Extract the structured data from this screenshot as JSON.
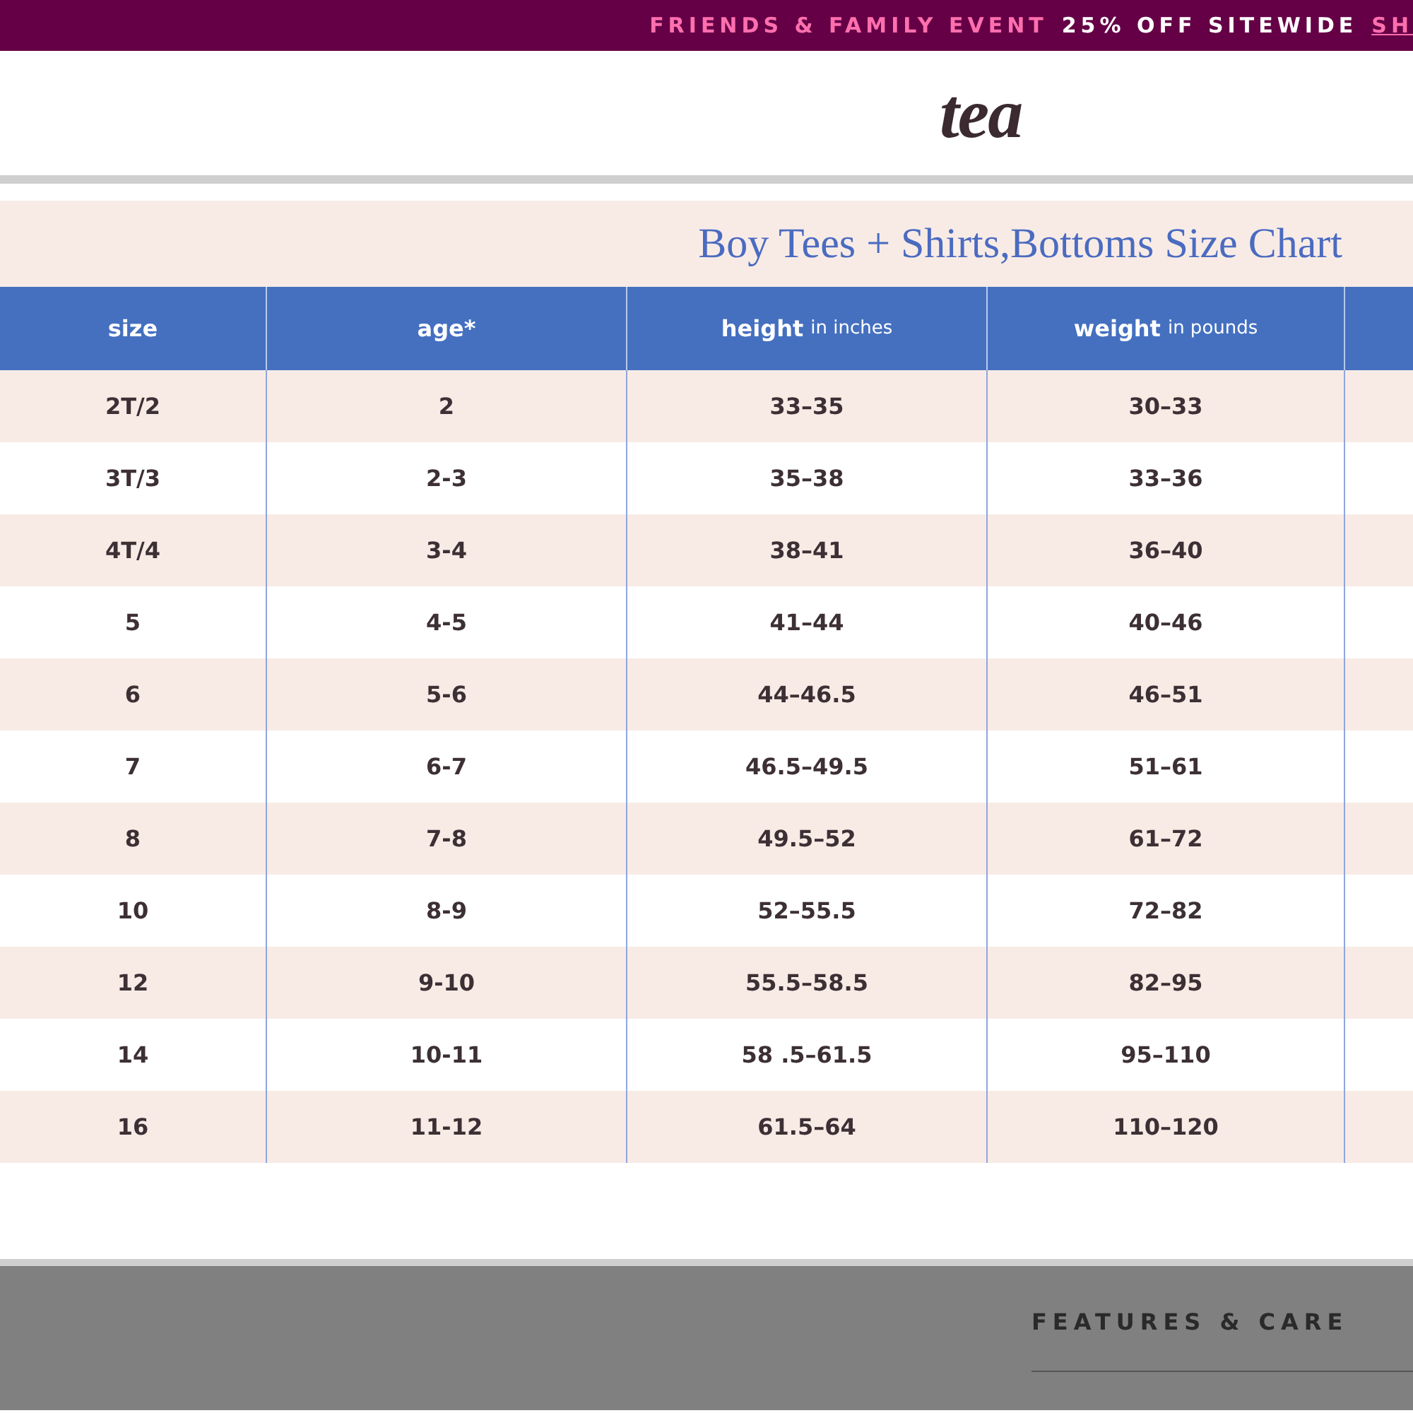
{
  "promo_banner": {
    "event": "FRIENDS & FAMILY EVENT",
    "offer": "25% OFF SITEWIDE",
    "link": "SH"
  },
  "header": {
    "logo": "tea"
  },
  "size_chart": {
    "title": "Boy Tees + Shirts,Bottoms Size Chart",
    "columns": [
      {
        "label": "size"
      },
      {
        "label": "age*"
      },
      {
        "label": "height",
        "unit": "in inches"
      },
      {
        "label": "weight",
        "unit": "in pounds"
      }
    ],
    "rows": [
      [
        "2T/2",
        "2",
        "33–35",
        "30–33"
      ],
      [
        "3T/3",
        "2-3",
        "35–38",
        "33–36"
      ],
      [
        "4T/4",
        "3-4",
        "38–41",
        "36–40"
      ],
      [
        "5",
        "4-5",
        "41–44",
        "40–46"
      ],
      [
        "6",
        "5-6",
        "44–46.5",
        "46–51"
      ],
      [
        "7",
        "6-7",
        "46.5–49.5",
        "51–61"
      ],
      [
        "8",
        "7-8",
        "49.5–52",
        "61–72"
      ],
      [
        "10",
        "8-9",
        "52–55.5",
        "72–82"
      ],
      [
        "12",
        "9-10",
        "55.5–58.5",
        "82–95"
      ],
      [
        "14",
        "10-11",
        "58 .5–61.5",
        "95–110"
      ],
      [
        "16",
        "11-12",
        "61.5–64",
        "110–120"
      ]
    ]
  },
  "footer": {
    "section_title": "FEATURES & CARE"
  }
}
